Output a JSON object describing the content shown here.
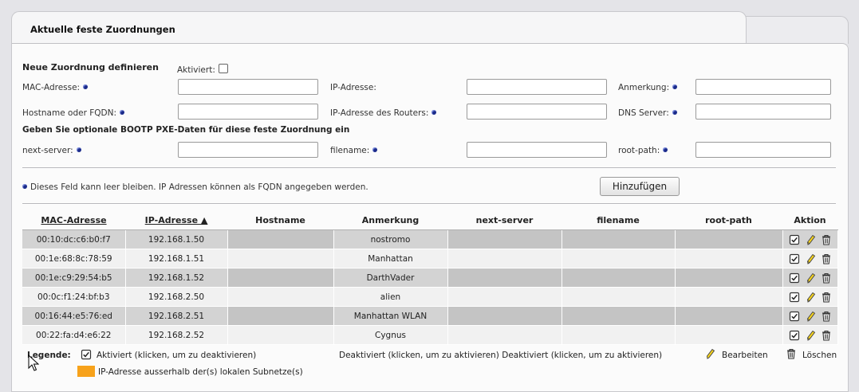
{
  "window": {
    "title": "Aktuelle feste Zuordnungen"
  },
  "form": {
    "heading": "Neue Zuordnung definieren",
    "activated_label": "Aktiviert:",
    "mac_label": "MAC-Adresse:",
    "ip_label": "IP-Adresse:",
    "remark_label": "Anmerkung:",
    "hostname_label": "Hostname oder FQDN:",
    "router_label": "IP-Adresse des Routers:",
    "dns_label": "DNS Server:",
    "bootp_heading": "Geben Sie optionale BOOTP PXE-Daten für diese feste Zuordnung ein",
    "nextserver_label": "next-server:",
    "filename_label": "filename:",
    "rootpath_label": "root-path:",
    "note": "Dieses Feld kann leer bleiben.  IP Adressen können als FQDN angegeben werden.",
    "add_button": "Hinzufügen",
    "values": {
      "mac": "",
      "ip": "",
      "remark": "",
      "hostname": "",
      "router": "",
      "dns": "",
      "nextserver": "",
      "filename": "",
      "rootpath": ""
    }
  },
  "table": {
    "headers": {
      "mac": "MAC-Adresse",
      "ip": "IP-Adresse ▲",
      "hostname": "Hostname",
      "remark": "Anmerkung",
      "nextserver": "next-server",
      "filename": "filename",
      "rootpath": "root-path",
      "action": "Aktion"
    },
    "rows": [
      {
        "mac": "00:10:dc:c6:b0:f7",
        "ip": "192.168.1.50",
        "hostname": "",
        "remark": "nostromo",
        "nextserver": "",
        "filename": "",
        "rootpath": ""
      },
      {
        "mac": "00:1e:68:8c:78:59",
        "ip": "192.168.1.51",
        "hostname": "",
        "remark": "Manhattan",
        "nextserver": "",
        "filename": "",
        "rootpath": ""
      },
      {
        "mac": "00:1e:c9:29:54:b5",
        "ip": "192.168.1.52",
        "hostname": "",
        "remark": "DarthVader",
        "nextserver": "",
        "filename": "",
        "rootpath": ""
      },
      {
        "mac": "00:0c:f1:24:bf:b3",
        "ip": "192.168.2.50",
        "hostname": "",
        "remark": "alien",
        "nextserver": "",
        "filename": "",
        "rootpath": ""
      },
      {
        "mac": "00:16:44:e5:76:ed",
        "ip": "192.168.2.51",
        "hostname": "",
        "remark": "Manhattan WLAN",
        "nextserver": "",
        "filename": "",
        "rootpath": ""
      },
      {
        "mac": "00:22:fa:d4:e6:22",
        "ip": "192.168.2.52",
        "hostname": "",
        "remark": "Cygnus",
        "nextserver": "",
        "filename": "",
        "rootpath": ""
      }
    ]
  },
  "legend": {
    "label": "Legende:",
    "activated": "Aktiviert (klicken, um zu deaktivieren)",
    "deactivated": "Deaktiviert (klicken, um zu aktivieren) Deaktiviert (klicken, um zu aktivieren)",
    "edit": "Bearbeiten",
    "delete": "Löschen",
    "outside_subnet": "IP-Adresse ausserhalb der(s) lokalen Subnetze(s)"
  },
  "colors": {
    "outside_subnet": "#f7a21b",
    "info_dot": "#1a2a8a"
  },
  "icons": [
    "info-dot-icon",
    "checkbox-checked-icon",
    "pencil-icon",
    "trash-icon",
    "mouse-cursor-icon"
  ]
}
